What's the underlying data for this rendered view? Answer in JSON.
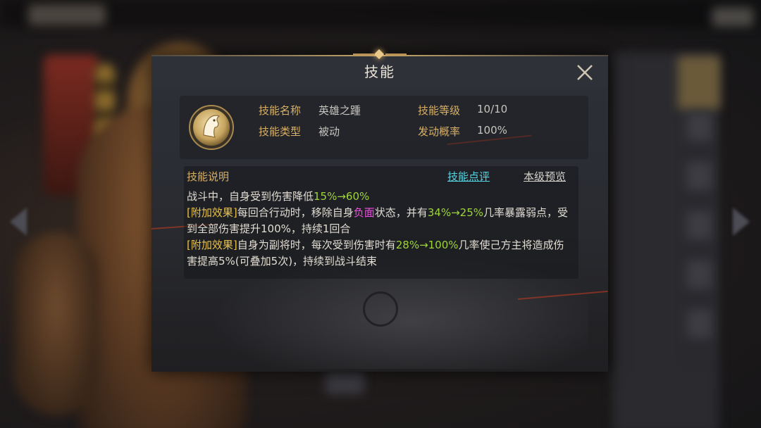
{
  "modal": {
    "title": "技能",
    "close_icon": "close-icon"
  },
  "skill": {
    "icon": "horse-head-icon",
    "name_label": "技能名称",
    "name_value": "英雄之踵",
    "level_label": "技能等级",
    "level_value": "10/10",
    "type_label": "技能类型",
    "type_value": "被动",
    "rate_label": "发动概率",
    "rate_value": "100%"
  },
  "description": {
    "title": "技能说明",
    "review_link": "技能点评",
    "preview_link": "本级预览",
    "line1_text": "战斗中，自身受到伤害降低",
    "line1_value": "15%→60%",
    "effect_tag": "[附加效果]",
    "line2_a": "每回合行动时，移除自身",
    "line2_neg": "负面",
    "line2_b": "状态，并有",
    "line2_value": "34%→25%",
    "line2_c": "几率暴露弱点，受到全部伤害提升100%，持续1回合",
    "line3_a": "自身为副将时，每次受到伤害时有",
    "line3_value": "28%→100%",
    "line3_b": "几率使己方主将造成伤害提高5%(可叠加5次)，持续到战斗结束"
  },
  "colors": {
    "gold": "#d8b064",
    "green": "#9ed53a",
    "pink": "#f24ee2",
    "cyan": "#57d4e0"
  }
}
